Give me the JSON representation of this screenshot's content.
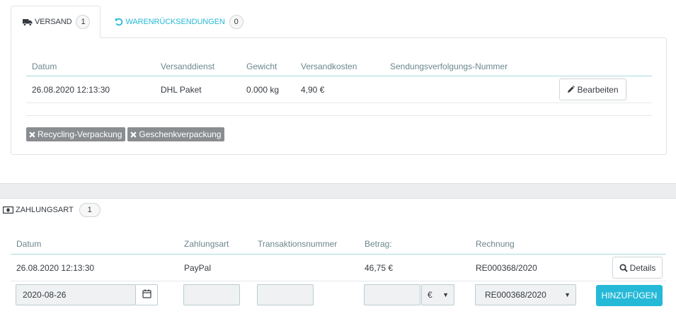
{
  "shipping": {
    "tabs": [
      {
        "label": "Versand",
        "count": "1",
        "icon": "truck-icon"
      },
      {
        "label": "Warenrücksendungen",
        "count": "0",
        "icon": "undo-icon"
      }
    ],
    "columns": [
      "Datum",
      "Versanddienst",
      "Gewicht",
      "Versandkosten",
      "Sendungsverfolgungs-Nummer"
    ],
    "rows": [
      {
        "date": "26.08.2020 12:13:30",
        "carrier": "DHL Paket",
        "weight": "0.000 kg",
        "cost": "4,90 €",
        "tracking": ""
      }
    ],
    "edit_label": "Bearbeiten",
    "tags": [
      "Recycling-Verpackung",
      "Geschenkverpackung"
    ]
  },
  "payment": {
    "title": "Zahlungsart",
    "count": "1",
    "columns": [
      "Datum",
      "Zahlungsart",
      "Transaktionsnummer",
      "Betrag:",
      "Rechnung"
    ],
    "rows": [
      {
        "date": "26.08.2020 12:13:30",
        "method": "PayPal",
        "transaction": "",
        "amount": "46,75 €",
        "invoice": "RE000368/2020"
      }
    ],
    "details_label": "Details",
    "form": {
      "date_value": "2020-08-26",
      "method_value": "",
      "transaction_value": "",
      "amount_value": "",
      "currency": "€",
      "invoice": "RE000368/2020",
      "add_label": "Hinzufügen"
    }
  },
  "colors": {
    "accent": "#25b9d7",
    "tag_bg": "#8a8d90",
    "header_text": "#6c868e",
    "input_bg": "#eff1f2"
  }
}
